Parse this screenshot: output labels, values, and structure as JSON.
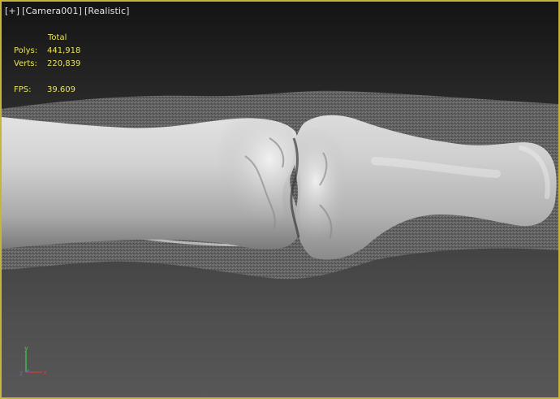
{
  "viewport": {
    "labels": {
      "menu": "[+]",
      "camera": "[Camera001]",
      "shading": "[Realistic]"
    },
    "stats": {
      "column_header": "Total",
      "polys_label": "Polys:",
      "polys_value": "441,918",
      "verts_label": "Verts:",
      "verts_value": "220,839",
      "fps_label": "FPS:",
      "fps_value": "39.609"
    },
    "axis_gizmo": {
      "x": "x",
      "y": "y",
      "z": "z"
    },
    "colors": {
      "active_border": "#c8b33c",
      "stats_text": "#e9e45e",
      "label_text": "#e6e6e6",
      "axis_x": "#d23a3a",
      "axis_y": "#3fcf4a",
      "axis_z": "#4a6cff"
    }
  }
}
